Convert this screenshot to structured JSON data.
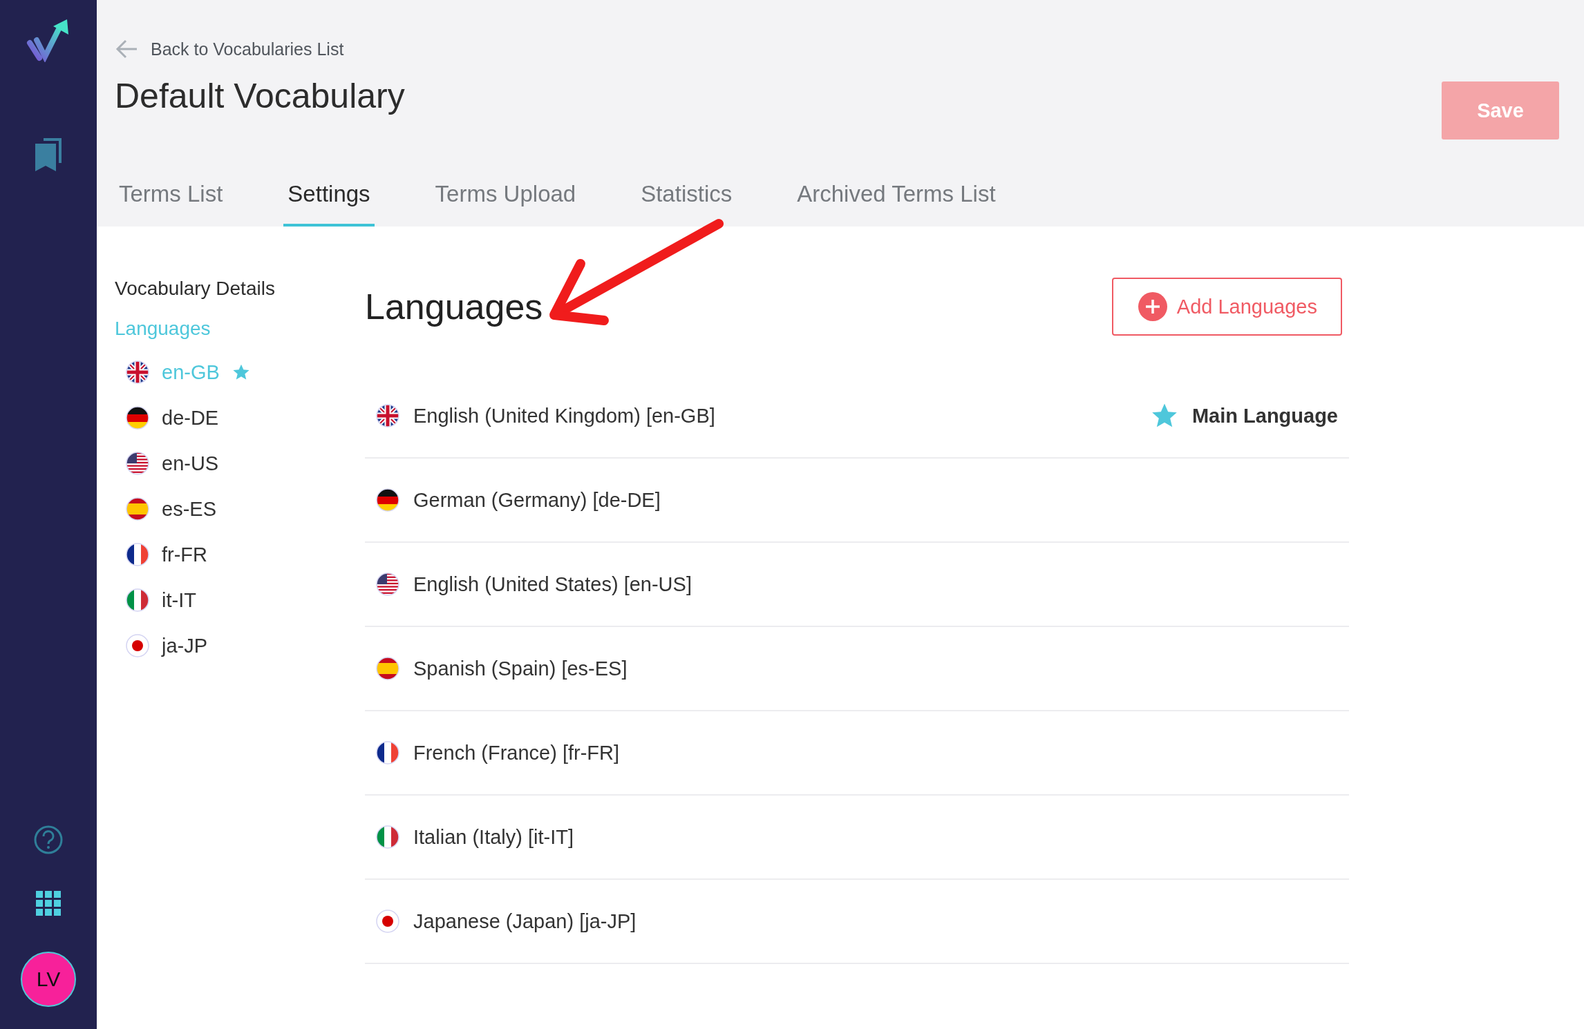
{
  "sidebar": {
    "avatar": "LV"
  },
  "header": {
    "back_link": "Back to Vocabularies List",
    "title": "Default Vocabulary",
    "save_button": {
      "label": "Save",
      "disabled": true
    }
  },
  "tabs": [
    {
      "label": "Terms List",
      "selected": false
    },
    {
      "label": "Settings",
      "selected": true
    },
    {
      "label": "Terms Upload",
      "selected": false
    },
    {
      "label": "Statistics",
      "selected": false
    },
    {
      "label": "Archived Terms List",
      "selected": false
    }
  ],
  "settings_nav": [
    {
      "label": "Vocabulary Details",
      "selected": false
    },
    {
      "label": "Languages",
      "selected": true,
      "children": [
        {
          "label": "en-GB",
          "kind": "uk",
          "selected": true,
          "main": true
        },
        {
          "label": "de-DE",
          "kind": "de",
          "selected": false,
          "main": false
        },
        {
          "label": "en-US",
          "kind": "us",
          "selected": false,
          "main": false
        },
        {
          "label": "es-ES",
          "kind": "es",
          "selected": false,
          "main": false
        },
        {
          "label": "fr-FR",
          "kind": "fr",
          "selected": false,
          "main": false
        },
        {
          "label": "it-IT",
          "kind": "it",
          "selected": false,
          "main": false
        },
        {
          "label": "ja-JP",
          "kind": "jp",
          "selected": false,
          "main": false
        }
      ]
    }
  ],
  "languages": {
    "heading": "Languages",
    "add_button": "Add Languages",
    "rows": [
      {
        "name": "English (United Kingdom) [en-GB]",
        "kind": "uk",
        "main": true,
        "badge": "Main Language"
      },
      {
        "name": "German (Germany) [de-DE]",
        "kind": "de",
        "main": false
      },
      {
        "name": "English (United States) [en-US]",
        "kind": "us",
        "main": false
      },
      {
        "name": "Spanish (Spain) [es-ES]",
        "kind": "es",
        "main": false
      },
      {
        "name": "French (France) [fr-FR]",
        "kind": "fr",
        "main": false
      },
      {
        "name": "Italian (Italy) [it-IT]",
        "kind": "it",
        "main": false
      },
      {
        "name": "Japanese (Japan) [ja-JP]",
        "kind": "jp",
        "main": false
      }
    ]
  }
}
